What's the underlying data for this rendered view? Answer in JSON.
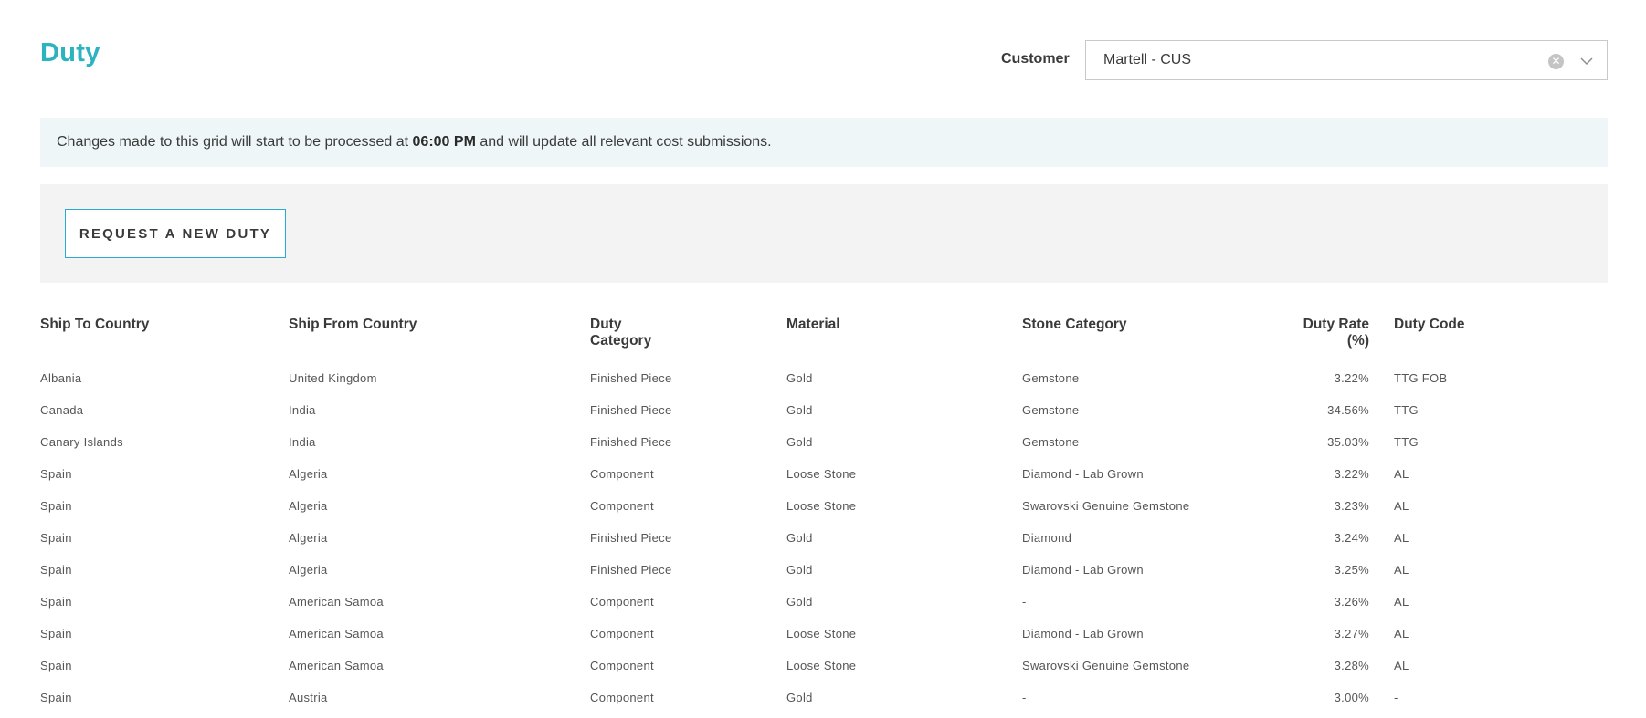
{
  "page": {
    "title": "Duty"
  },
  "customer": {
    "label": "Customer",
    "value": "Martell - CUS",
    "clear_icon": "clear-circle-icon",
    "chevron_icon": "chevron-down-icon"
  },
  "notice": {
    "prefix": "Changes made to this grid will start to be processed at ",
    "time": "06:00 PM",
    "suffix": " and will update all relevant cost submissions."
  },
  "actions": {
    "request_label": "REQUEST A NEW DUTY"
  },
  "table": {
    "headers": {
      "ship_to": "Ship To Country",
      "ship_from": "Ship From Country",
      "duty_category_1": "Duty",
      "duty_category_2": "Category",
      "material": "Material",
      "stone_category": "Stone Category",
      "duty_rate_1": "Duty Rate",
      "duty_rate_2": "(%)",
      "duty_code": "Duty Code"
    },
    "rows": [
      {
        "ship_to": "Albania",
        "ship_from": "United Kingdom",
        "duty_category": "Finished Piece",
        "material": "Gold",
        "stone_category": "Gemstone",
        "duty_rate": "3.22%",
        "duty_code": "TTG FOB"
      },
      {
        "ship_to": "Canada",
        "ship_from": "India",
        "duty_category": "Finished Piece",
        "material": "Gold",
        "stone_category": "Gemstone",
        "duty_rate": "34.56%",
        "duty_code": "TTG"
      },
      {
        "ship_to": "Canary Islands",
        "ship_from": "India",
        "duty_category": "Finished Piece",
        "material": "Gold",
        "stone_category": "Gemstone",
        "duty_rate": "35.03%",
        "duty_code": "TTG"
      },
      {
        "ship_to": "Spain",
        "ship_from": "Algeria",
        "duty_category": "Component",
        "material": "Loose Stone",
        "stone_category": "Diamond - Lab Grown",
        "duty_rate": "3.22%",
        "duty_code": "AL"
      },
      {
        "ship_to": "Spain",
        "ship_from": "Algeria",
        "duty_category": "Component",
        "material": "Loose Stone",
        "stone_category": "Swarovski Genuine Gemstone",
        "duty_rate": "3.23%",
        "duty_code": "AL"
      },
      {
        "ship_to": "Spain",
        "ship_from": "Algeria",
        "duty_category": "Finished Piece",
        "material": "Gold",
        "stone_category": "Diamond",
        "duty_rate": "3.24%",
        "duty_code": "AL"
      },
      {
        "ship_to": "Spain",
        "ship_from": "Algeria",
        "duty_category": "Finished Piece",
        "material": "Gold",
        "stone_category": "Diamond - Lab Grown",
        "duty_rate": "3.25%",
        "duty_code": "AL"
      },
      {
        "ship_to": "Spain",
        "ship_from": "American Samoa",
        "duty_category": "Component",
        "material": "Gold",
        "stone_category": "-",
        "duty_rate": "3.26%",
        "duty_code": "AL"
      },
      {
        "ship_to": "Spain",
        "ship_from": "American Samoa",
        "duty_category": "Component",
        "material": "Loose Stone",
        "stone_category": "Diamond - Lab Grown",
        "duty_rate": "3.27%",
        "duty_code": "AL"
      },
      {
        "ship_to": "Spain",
        "ship_from": "American Samoa",
        "duty_category": "Component",
        "material": "Loose Stone",
        "stone_category": "Swarovski Genuine Gemstone",
        "duty_rate": "3.28%",
        "duty_code": "AL"
      },
      {
        "ship_to": "Spain",
        "ship_from": "Austria",
        "duty_category": "Component",
        "material": "Gold",
        "stone_category": "-",
        "duty_rate": "3.00%",
        "duty_code": "-"
      }
    ]
  },
  "colors": {
    "accent": "#2bb3c0",
    "button_border": "#2aa9d2",
    "notice_bg": "#eef6f8",
    "action_bar_bg": "#f3f3f3"
  }
}
